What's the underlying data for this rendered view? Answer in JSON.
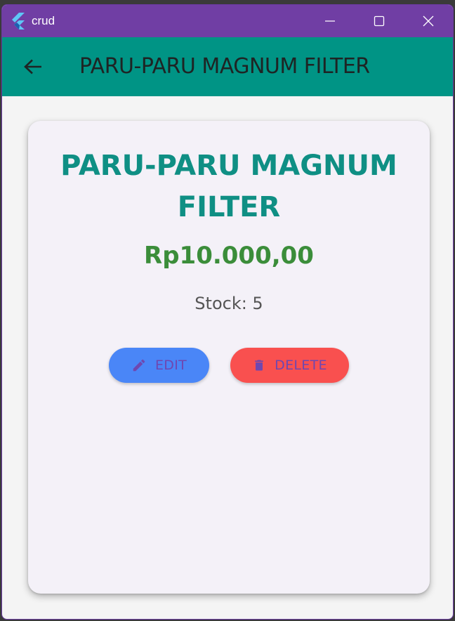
{
  "window": {
    "title": "crud",
    "controls": [
      "minimize-icon",
      "maximize-icon",
      "close-icon"
    ],
    "titlebar_color": "#703ea4"
  },
  "appbar": {
    "back_icon": "arrow-back-icon",
    "title": "PARU-PARU MAGNUM FILTER",
    "color": "#009485"
  },
  "product": {
    "name": "PARU-PARU MAGNUM FILTER",
    "price": "Rp10.000,00",
    "stock": "Stock: 5"
  },
  "actions": {
    "edit": {
      "label": "EDIT",
      "icon": "pencil-icon",
      "color": "#4a86f7"
    },
    "delete": {
      "label": "DELETE",
      "icon": "trash-icon",
      "color": "#f9504f"
    }
  }
}
